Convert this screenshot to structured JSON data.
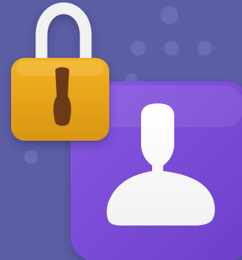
{
  "scene": {
    "background_color": "#5b5ea3",
    "background_dot_color": "#6a6db0"
  },
  "illustration": {
    "padlock": {
      "icon": "padlock-icon",
      "body_color": "#f2b321",
      "body_shade_color": "#d99612",
      "shackle_color": "#f1f1f3",
      "keyhole_color": "#6c3a12"
    },
    "user_tile": {
      "icon": "user-icon",
      "tile_color": "#8758e3",
      "tile_shade_color": "#6d3fc8",
      "figure_color": "#f2f2f4"
    }
  }
}
